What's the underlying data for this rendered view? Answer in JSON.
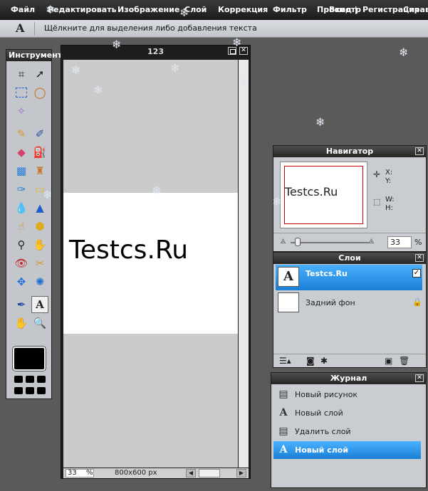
{
  "menu": {
    "items": [
      "Файл",
      "Редактировать",
      "Изображение",
      "Слой",
      "Коррекция",
      "Фильтр",
      "Просмотр",
      "Вход |",
      "Регистрация",
      "Справка"
    ]
  },
  "options_bar": {
    "tool_icon": "text-tool-icon",
    "hint": "Щёлкните для выделения либо добавления текста"
  },
  "toolbox": {
    "title": "Инструменты"
  },
  "document": {
    "title": "123",
    "canvas_text": "Testcs.Ru",
    "zoom": "33",
    "zoom_unit": "%",
    "size": "800x600 px"
  },
  "navigator": {
    "title": "Навигатор",
    "thumb_text": "Testcs.Ru",
    "x_label": "X:",
    "y_label": "Y:",
    "w_label": "W:",
    "h_label": "H:",
    "zoom": "33",
    "zoom_unit": "%"
  },
  "layers": {
    "title": "Слои",
    "items": [
      {
        "name": "Testcs.Ru",
        "selected": true
      },
      {
        "name": "Задний фон",
        "selected": false
      }
    ]
  },
  "history": {
    "title": "Журнал",
    "items": [
      {
        "label": "Новый рисунок",
        "selected": false
      },
      {
        "label": "Новый слой",
        "selected": false
      },
      {
        "label": "Удалить слой",
        "selected": false
      },
      {
        "label": "Новый слой",
        "selected": true
      }
    ]
  },
  "colors": {
    "accent": "#2a93ee",
    "panel": "#c9ccd0",
    "workspace": "#5a5a5a"
  }
}
